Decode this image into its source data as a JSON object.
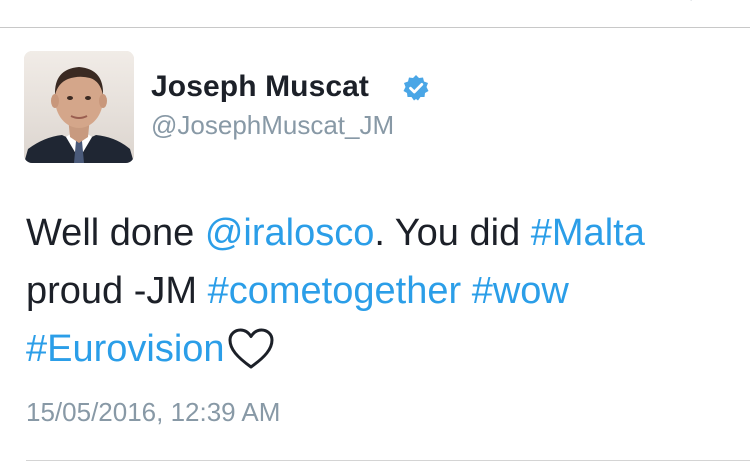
{
  "tweet": {
    "author": {
      "display_name": "Joseph Muscat",
      "handle": "@JosephMuscat_JM",
      "verified_icon": "verified-badge-icon",
      "avatar": "profile-photo"
    },
    "text": {
      "line1": {
        "p1": "Well done ",
        "mention": "@iralosco",
        "p2": ". You did ",
        "hashtag_malta": "#Malta"
      },
      "line2": {
        "p1": "proud -JM ",
        "hashtag_cometogether": "#cometogether",
        "space": " ",
        "hashtag_wow": "#wow"
      },
      "line3": {
        "hashtag_eurovision": "#Eurovision",
        "heart_icon": "heart-outline-icon"
      }
    },
    "timestamp": "15/05/2016, 12:39 AM"
  },
  "colors": {
    "link": "#2b9ee8",
    "text": "#1c2028",
    "muted": "#8899a6",
    "verified": "#4aa6e6"
  }
}
